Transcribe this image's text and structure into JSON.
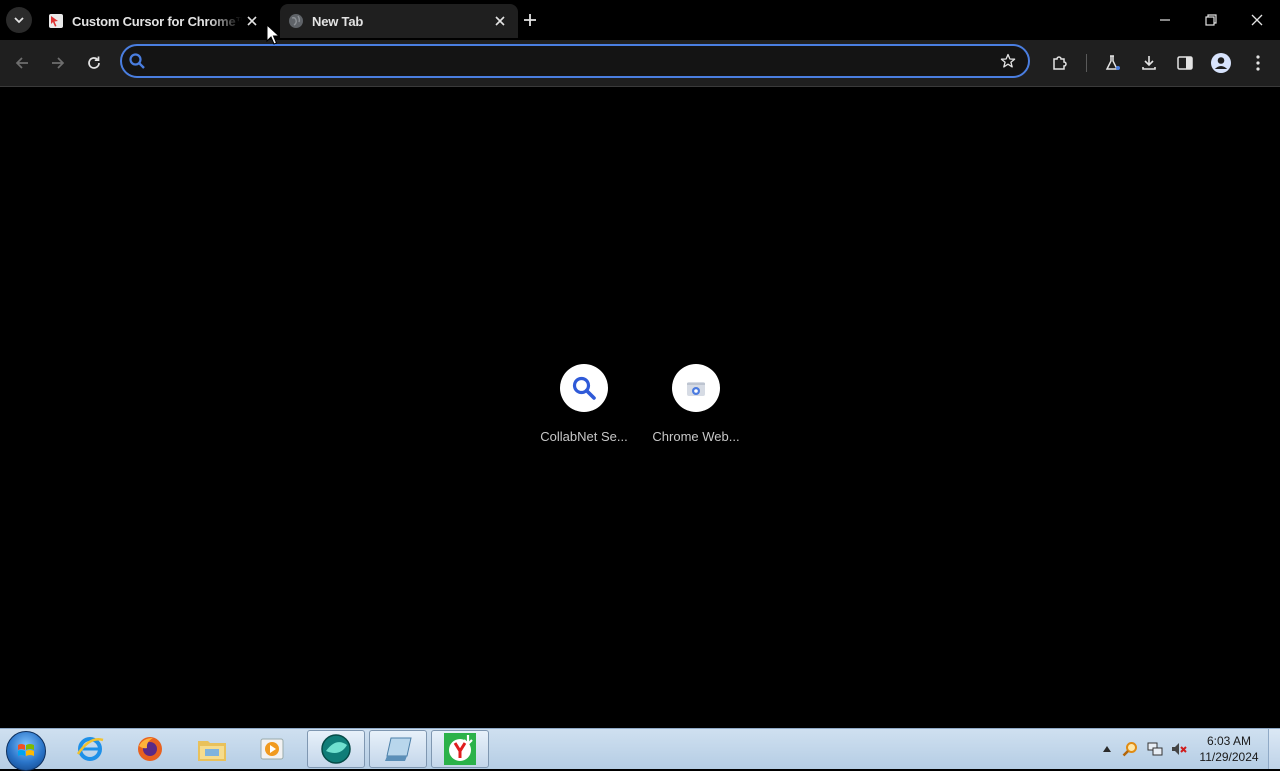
{
  "browser": {
    "tabs": [
      {
        "title": "Custom Cursor for Chrome™ -",
        "active": false,
        "favicon": "custom-cursor-favicon"
      },
      {
        "title": "New Tab",
        "active": true,
        "favicon": "globe-icon"
      }
    ],
    "omnibox": {
      "value": "",
      "placeholder": ""
    },
    "accent_color": "#4a7ee0"
  },
  "ntp": {
    "shortcuts": [
      {
        "label": "CollabNet Se...",
        "icon": "search-icon"
      },
      {
        "label": "Chrome Web...",
        "icon": "chrome-web-store-icon"
      }
    ]
  },
  "taskbar": {
    "apps": [
      {
        "name": "internet-explorer-icon"
      },
      {
        "name": "firefox-icon"
      },
      {
        "name": "file-explorer-icon"
      },
      {
        "name": "media-player-icon"
      },
      {
        "name": "app-teal-icon"
      },
      {
        "name": "app-notepad-icon"
      },
      {
        "name": "yandex-browser-icon"
      }
    ],
    "clock": {
      "time": "6:03 AM",
      "date": "11/29/2024"
    }
  }
}
